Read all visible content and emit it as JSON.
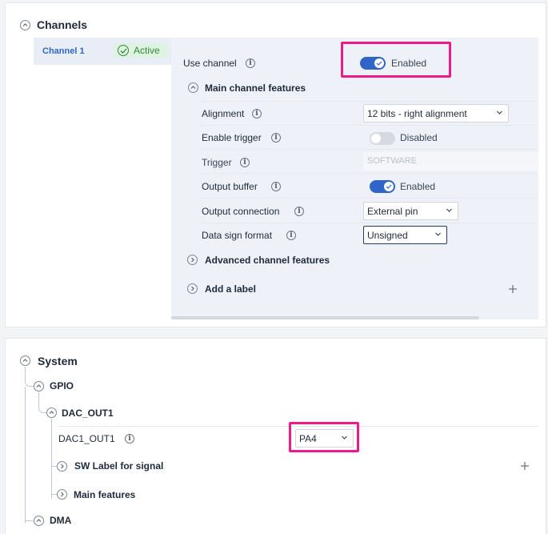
{
  "channels": {
    "title": "Channels",
    "channel_tab": {
      "label": "Channel 1",
      "status": "Active"
    },
    "use_channel": {
      "label": "Use channel",
      "value": "Enabled"
    },
    "main_features": {
      "title": "Main channel features",
      "alignment": {
        "label": "Alignment",
        "value": "12 bits - right alignment"
      },
      "enable_trigger": {
        "label": "Enable trigger",
        "value": "Disabled"
      },
      "trigger": {
        "label": "Trigger",
        "value": "SOFTWARE"
      },
      "output_buffer": {
        "label": "Output buffer",
        "value": "Enabled"
      },
      "output_connection": {
        "label": "Output connection",
        "value": "External pin"
      },
      "data_sign_format": {
        "label": "Data sign format",
        "value": "Unsigned"
      }
    },
    "advanced_features": "Advanced channel features",
    "add_label": "Add a label"
  },
  "system": {
    "title": "System",
    "gpio": "GPIO",
    "dac_out1": "DAC_OUT1",
    "dac1_out1": {
      "label": "DAC1_OUT1",
      "value": "PA4"
    },
    "sw_label": "SW Label for signal",
    "main_features": "Main features",
    "dma": "DMA"
  },
  "colors": {
    "accent": "#2f65c8",
    "highlight": "#ef1a8a",
    "active_green": "#2e8b3a",
    "panel_bg": "#eef2f8"
  }
}
